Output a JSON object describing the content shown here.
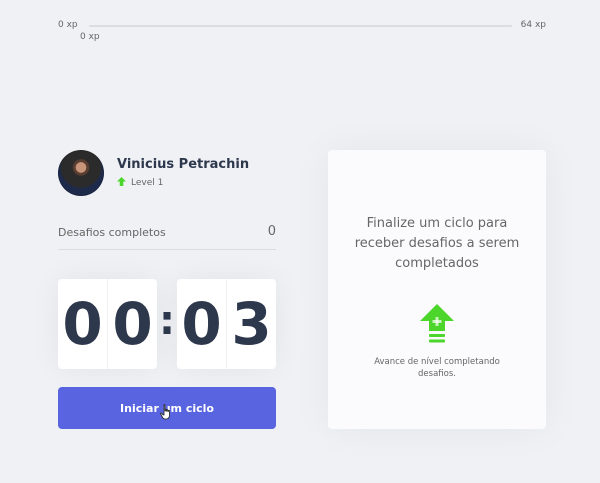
{
  "experience": {
    "min_label": "0 xp",
    "max_label": "64 xp",
    "current_label": "0 xp",
    "progress_fraction": 0
  },
  "profile": {
    "name": "Vinicius Petrachin",
    "level": "Level 1",
    "level_icon": "level-up-arrow-icon"
  },
  "completed": {
    "label": "Desafios completos",
    "count": "0"
  },
  "countdown": {
    "minutes": [
      "0",
      "0"
    ],
    "colon": ":",
    "seconds": [
      "0",
      "3"
    ]
  },
  "start_button": {
    "label": "Iniciar um ciclo"
  },
  "challenge_card": {
    "title": "Finalize um ciclo para receber desafios a serem completados",
    "icon": "level-up-icon",
    "hint": "Avance de nível completando desafios."
  },
  "colors": {
    "background": "#f0f1f5",
    "accent_button": "#5965e0",
    "green": "#4cd62b",
    "title_text": "#2e384d",
    "body_text": "#666666"
  }
}
